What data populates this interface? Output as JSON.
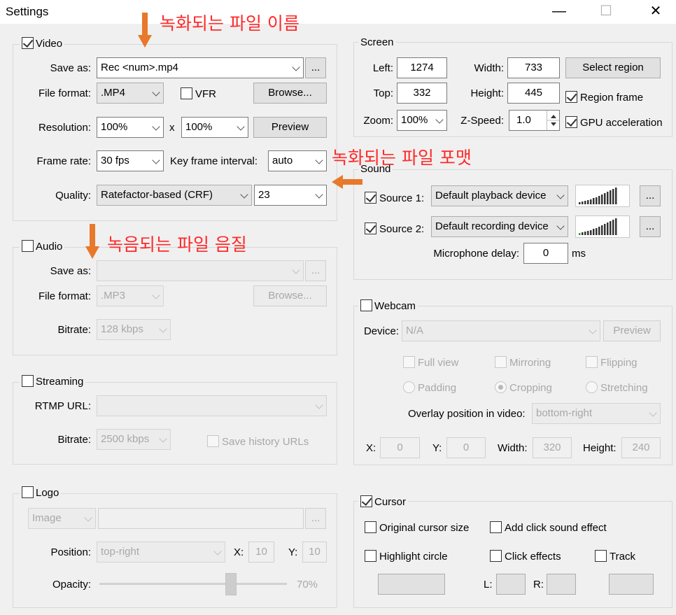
{
  "window": {
    "title": "Settings",
    "minimize": "—",
    "maximize": "☐",
    "close": "✕"
  },
  "annotations": {
    "filename": "녹화되는 파일 이름",
    "format": "녹화되는 파일 포맷",
    "audio_quality": "녹음되는 파일 음질"
  },
  "video": {
    "legend": "Video",
    "checked": true,
    "save_as_label": "Save as:",
    "save_as_value": "Rec <num>.mp4",
    "more_btn": "...",
    "format_label": "File format:",
    "format_value": ".MP4",
    "vfr_label": "VFR",
    "browse_btn": "Browse...",
    "resolution_label": "Resolution:",
    "res_w": "100%",
    "res_x": "x",
    "res_h": "100%",
    "preview_btn": "Preview",
    "framerate_label": "Frame rate:",
    "framerate_value": "30 fps",
    "keyframe_label": "Key frame interval:",
    "keyframe_value": "auto",
    "quality_label": "Quality:",
    "quality_value": "Ratefactor-based (CRF)",
    "quality_num": "23"
  },
  "audio": {
    "legend": "Audio",
    "checked": false,
    "save_as_label": "Save as:",
    "save_as_value": "",
    "more_btn": "...",
    "format_label": "File format:",
    "format_value": ".MP3",
    "browse_btn": "Browse...",
    "bitrate_label": "Bitrate:",
    "bitrate_value": "128 kbps"
  },
  "streaming": {
    "legend": "Streaming",
    "checked": false,
    "rtmp_label": "RTMP URL:",
    "rtmp_value": "",
    "bitrate_label": "Bitrate:",
    "bitrate_value": "2500 kbps",
    "save_history_label": "Save history URLs"
  },
  "logo": {
    "legend": "Logo",
    "checked": false,
    "type_value": "Image",
    "path_value": "",
    "more_btn": "...",
    "position_label": "Position:",
    "position_value": "top-right",
    "x_label": "X:",
    "x_value": "10",
    "y_label": "Y:",
    "y_value": "10",
    "opacity_label": "Opacity:",
    "opacity_value": "70%",
    "opacity_level": 0.7
  },
  "screen": {
    "legend": "Screen",
    "left_label": "Left:",
    "left_value": "1274",
    "width_label": "Width:",
    "width_value": "733",
    "select_region_btn": "Select region",
    "top_label": "Top:",
    "top_value": "332",
    "height_label": "Height:",
    "height_value": "445",
    "region_frame_label": "Region frame",
    "region_frame_checked": true,
    "zoom_label": "Zoom:",
    "zoom_value": "100%",
    "zspeed_label": "Z-Speed:",
    "zspeed_value": "1.0",
    "gpu_label": "GPU acceleration",
    "gpu_checked": true
  },
  "sound": {
    "legend": "Sound",
    "source1_label": "Source 1:",
    "source1_checked": true,
    "source1_value": "Default playback device",
    "source2_label": "Source 2:",
    "source2_checked": true,
    "source2_value": "Default recording device",
    "more_btn": "...",
    "mic_delay_label": "Microphone delay:",
    "mic_delay_value": "0",
    "mic_delay_unit": "ms"
  },
  "webcam": {
    "legend": "Webcam",
    "checked": false,
    "device_label": "Device:",
    "device_value": "N/A",
    "preview_btn": "Preview",
    "full_view": "Full view",
    "mirroring": "Mirroring",
    "flipping": "Flipping",
    "padding": "Padding",
    "cropping": "Cropping",
    "stretching": "Stretching",
    "overlay_label": "Overlay position in video:",
    "overlay_value": "bottom-right",
    "x_label": "X:",
    "x_value": "0",
    "y_label": "Y:",
    "y_value": "0",
    "width_label": "Width:",
    "width_value": "320",
    "height_label": "Height:",
    "height_value": "240"
  },
  "cursor": {
    "legend": "Cursor",
    "checked": true,
    "original_size": "Original cursor size",
    "click_sound": "Add click sound effect",
    "highlight_circle": "Highlight circle",
    "click_effects": "Click effects",
    "track": "Track",
    "l_label": "L:",
    "r_label": "R:"
  },
  "colors": {
    "annotation": "#ff2a2a",
    "arrow": "#e8782a",
    "meter_green": "#22aa22",
    "meter_dark": "#333333"
  }
}
